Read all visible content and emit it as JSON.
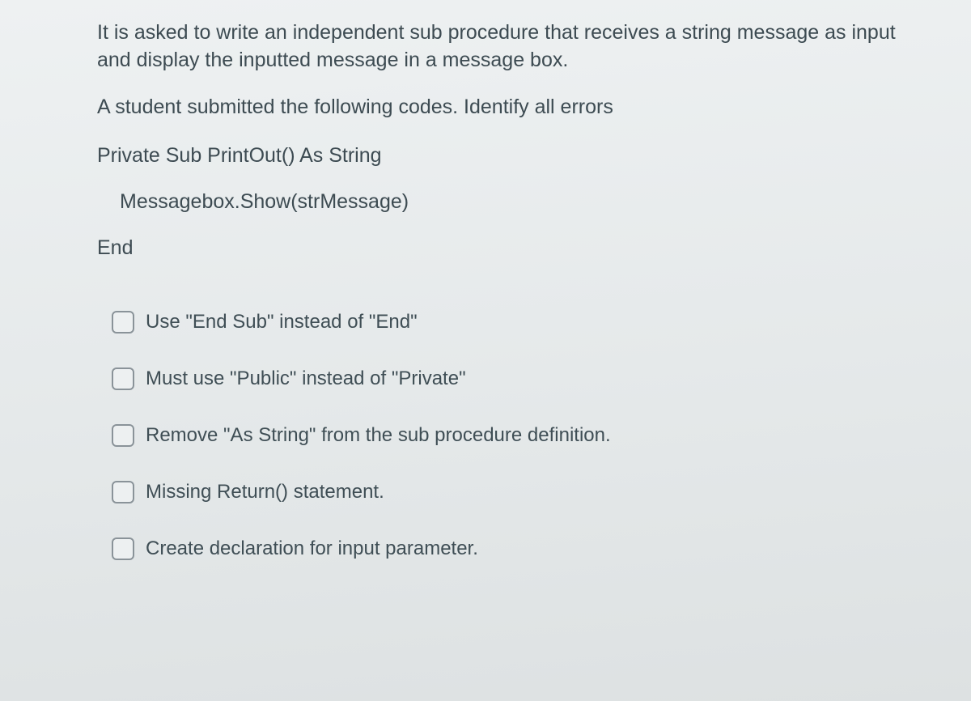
{
  "question": {
    "paragraph1": "It is asked to write an independent sub procedure that receives a string message as input and display the inputted message in a message box.",
    "paragraph2": "A student submitted the following codes.  Identify all errors"
  },
  "code": {
    "line1": "Private Sub PrintOut() As String",
    "line2": "Messagebox.Show(strMessage)",
    "line3": "End"
  },
  "options": [
    {
      "label": "Use \"End Sub\" instead of \"End\""
    },
    {
      "label": "Must use \"Public\" instead of \"Private\""
    },
    {
      "label": "Remove \"As String\" from the sub procedure definition."
    },
    {
      "label": "Missing Return() statement."
    },
    {
      "label": "Create declaration for input parameter."
    }
  ]
}
